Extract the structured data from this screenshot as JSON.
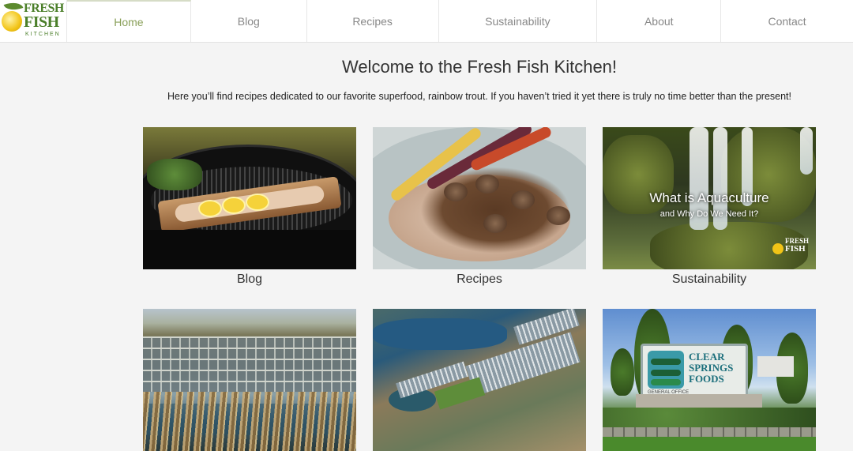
{
  "logo": {
    "line1": "FRESH",
    "line2": "FISH",
    "line3": "KITCHEN"
  },
  "nav": {
    "home": "Home",
    "blog": "Blog",
    "recipes": "Recipes",
    "sustainability": "Sustainability",
    "about": "About",
    "contact": "Contact"
  },
  "main": {
    "title": "Welcome to the Fresh Fish Kitchen!",
    "intro": "Here you’ll find recipes dedicated to our favorite superfood, rainbow trout. If you haven’t tried it yet there is truly no time better than the present!"
  },
  "tiles": {
    "blog_caption": "Blog",
    "recipes_caption": "Recipes",
    "sustainability_caption": "Sustainability",
    "aqua_title": "What is Aquaculture",
    "aqua_subtitle": "and Why Do We Need It?",
    "aqua_logo_line1": "FRESH",
    "aqua_logo_line2": "FISH",
    "sign_line1": "CLEAR",
    "sign_line2": "SPRINGS",
    "sign_line3": "FOODS",
    "sign_line4": "GENERAL OFFICE"
  },
  "colors": {
    "active_nav": "#8aa05a",
    "brand_green": "#4b7f2a"
  }
}
